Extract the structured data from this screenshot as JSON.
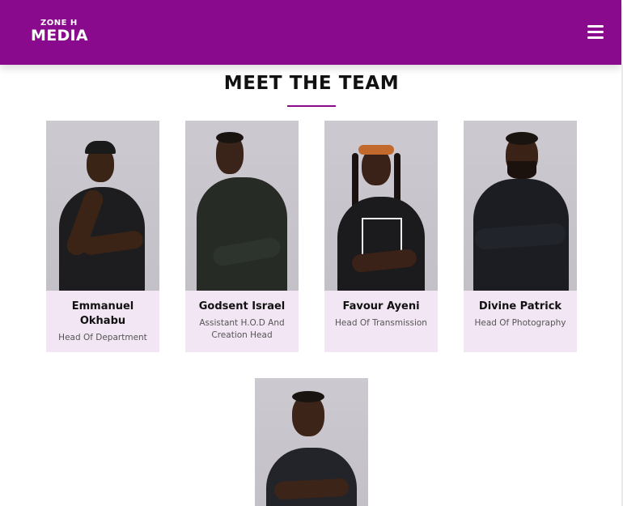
{
  "header": {
    "logo_top": "ZONE H",
    "logo_main": "MEDIA",
    "menu_icon": "hamburger-menu-icon",
    "brand_color": "#8a0a8e"
  },
  "section": {
    "title": "MEET THE TEAM",
    "accent_color": "#8a0a8e"
  },
  "team": [
    {
      "name": "Emmanuel Okhabu",
      "role": "Head Of Department"
    },
    {
      "name": "Godsent Israel",
      "role": "Assistant H.O.D And Creation Head"
    },
    {
      "name": "Favour Ayeni",
      "role": "Head Of Transmission"
    },
    {
      "name": "Divine Patrick",
      "role": "Head Of Photography"
    }
  ],
  "card_background": "#f2e6f4"
}
